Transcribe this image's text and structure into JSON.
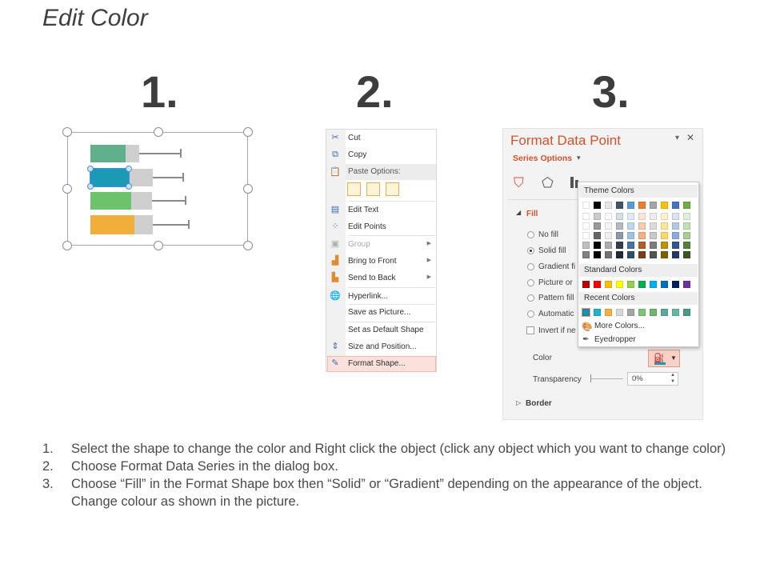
{
  "title": "Edit Color",
  "step_numbers": [
    "1.",
    "2.",
    "3."
  ],
  "context_menu": {
    "items": [
      {
        "label": "Cut",
        "icon": "scissors-icon",
        "disabled": false
      },
      {
        "label": "Copy",
        "icon": "copy-icon",
        "disabled": false
      },
      {
        "label": "Paste Options:",
        "icon": "paste-icon",
        "disabled": false
      },
      {
        "label": "Edit Text",
        "icon": "edit-text-icon",
        "disabled": false
      },
      {
        "label": "Edit Points",
        "icon": "edit-points-icon",
        "disabled": false
      },
      {
        "label": "Group",
        "icon": "group-icon",
        "disabled": true
      },
      {
        "label": "Bring to Front",
        "icon": "bring-front-icon",
        "disabled": false
      },
      {
        "label": "Send to Back",
        "icon": "send-back-icon",
        "disabled": false
      },
      {
        "label": "Hyperlink...",
        "icon": "hyperlink-icon",
        "disabled": false
      },
      {
        "label": "Save as Picture...",
        "icon": "",
        "disabled": false
      },
      {
        "label": "Set as Default Shape",
        "icon": "",
        "disabled": false
      },
      {
        "label": "Size and Position...",
        "icon": "size-position-icon",
        "disabled": false
      },
      {
        "label": "Format Shape...",
        "icon": "format-shape-icon",
        "disabled": false
      }
    ]
  },
  "format_pane": {
    "title": "Format Data Point",
    "series_options": "Series Options",
    "fill_label": "Fill",
    "options": [
      "No fill",
      "Solid fill",
      "Gradient fi",
      "Picture or",
      "Pattern fill",
      "Automatic"
    ],
    "invert_label": "Invert if ne",
    "color_label": "Color",
    "transparency_label": "Transparency",
    "transparency_value": "0%",
    "border_label": "Border",
    "palette": {
      "theme_label": "Theme Colors",
      "standard_label": "Standard Colors",
      "recent_label": "Recent Colors",
      "more_colors": "More Colors...",
      "eyedropper": "Eyedropper",
      "theme_top": [
        "#ffffff",
        "#000000",
        "#e7e6e6",
        "#44546a",
        "#5b9bd5",
        "#ed7d31",
        "#a5a5a5",
        "#ffc000",
        "#4472c4",
        "#70ad47"
      ],
      "standard": [
        "#c00000",
        "#ff0000",
        "#ffc000",
        "#ffff00",
        "#92d050",
        "#00b050",
        "#00b0f0",
        "#0070c0",
        "#002060",
        "#7030a0"
      ],
      "recent": [
        "#1a8fb0",
        "#24b0d0",
        "#f4b043",
        "#d8d8d8",
        "#a6a6a6",
        "#7cc576",
        "#6bb86b",
        "#5aa99a",
        "#62b9a0",
        "#4a9a88"
      ]
    }
  },
  "instructions": [
    "Select the shape to change the color and Right click the object (click any object which you want to change color)",
    "Choose Format Data Series in the dialog box.",
    "Choose “Fill” in the Format Shape box then “Solid” or “Gradient” depending on the appearance of the object. Change colour as shown in the picture."
  ],
  "instruction_numbers": [
    "1.",
    "2.",
    "3."
  ],
  "colors": {
    "accent_orange": "#d0532d",
    "bar_teal_green": "#5fb08b",
    "bar_blue": "#1a9ab5",
    "bar_green": "#6cc36c",
    "bar_orange": "#f2ae3a"
  }
}
